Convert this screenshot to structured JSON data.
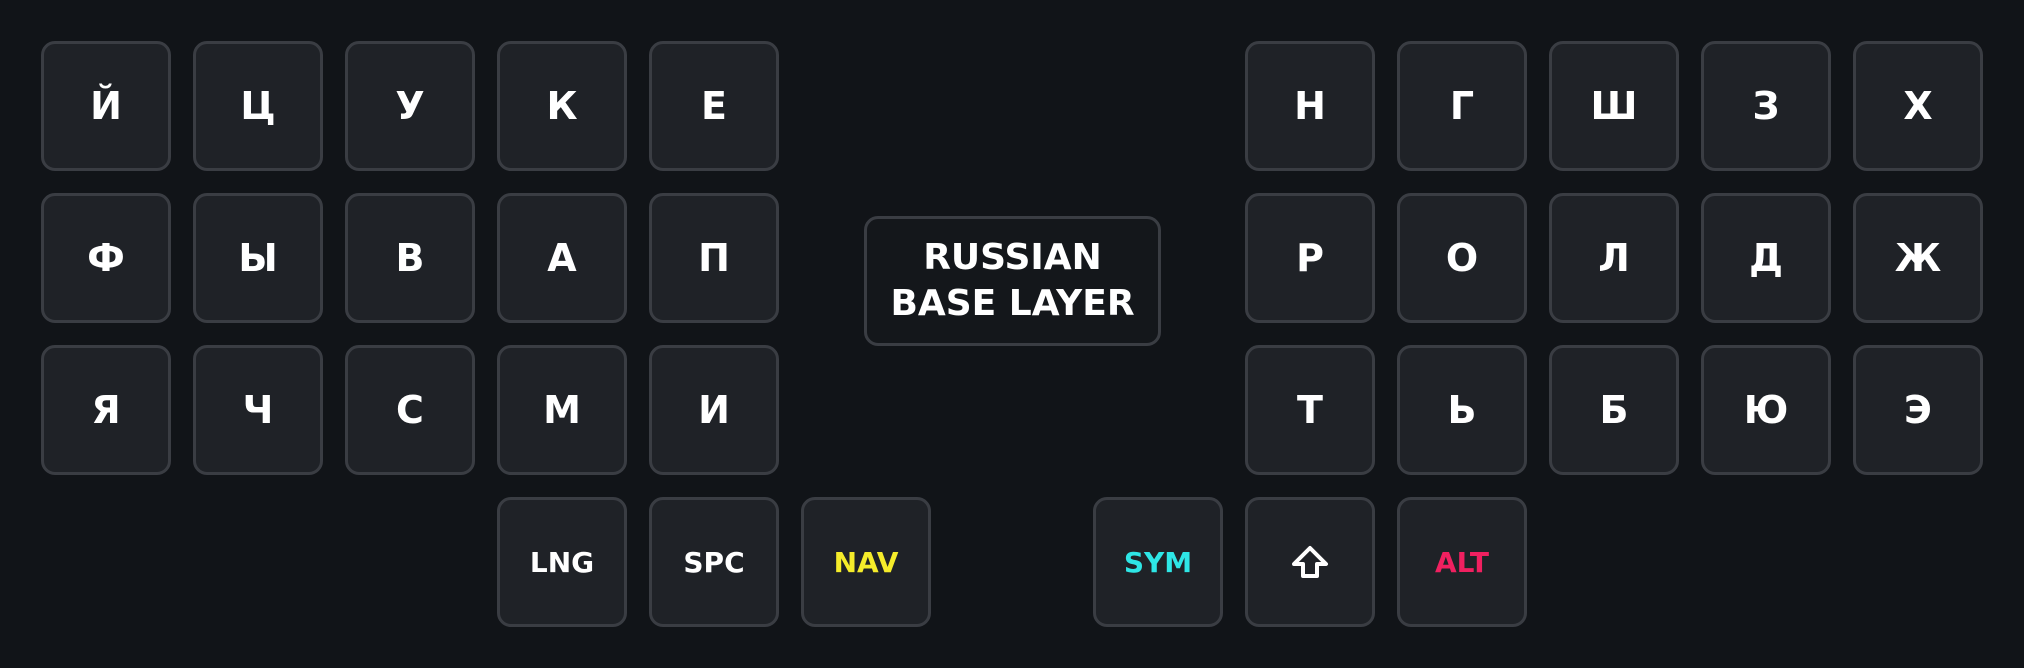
{
  "layer_label": {
    "line1": "RUSSIAN",
    "line2": "BASE LAYER"
  },
  "left": {
    "row1": [
      "Й",
      "Ц",
      "У",
      "К",
      "Е"
    ],
    "row2": [
      "Ф",
      "Ы",
      "В",
      "А",
      "П"
    ],
    "row3": [
      "Я",
      "Ч",
      "С",
      "М",
      "И"
    ]
  },
  "right": {
    "row1": [
      "Н",
      "Г",
      "Ш",
      "З",
      "Х"
    ],
    "row2": [
      "Р",
      "О",
      "Л",
      "Д",
      "Ж"
    ],
    "row3": [
      "Т",
      "Ь",
      "Б",
      "Ю",
      "Э"
    ]
  },
  "thumbs": {
    "lng": "LNG",
    "spc": "SPC",
    "nav": "NAV",
    "sym": "SYM",
    "shift_icon": "shift-arrow-icon",
    "alt": "ALT"
  },
  "colors": {
    "background": "#111418",
    "key": "#1f2227",
    "nav": "#f5ec2a",
    "sym": "#2ee6e6",
    "alt": "#f02060"
  }
}
